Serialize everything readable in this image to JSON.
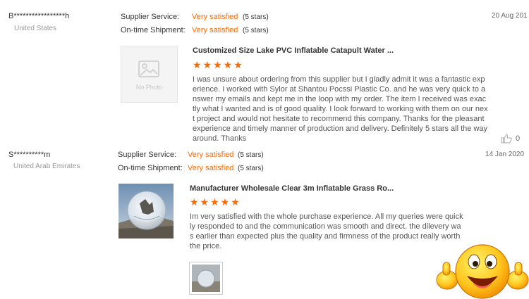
{
  "reviews": [
    {
      "buyer": "B*****************h",
      "country": "United States",
      "supplier_service_label": "Supplier Service:",
      "supplier_service_value": "Very satisfied",
      "supplier_service_stars": "(5 stars)",
      "shipment_label": "On-time Shipment:",
      "shipment_value": "Very satisfied",
      "shipment_stars": "(5 stars)",
      "date": "20 Aug 201",
      "photo_label": "No Photo",
      "product_title": "Customized Size Lake PVC Inflatable Catapult Water ...",
      "rating": 5,
      "stars": "★★★★★",
      "text": "I was unsure about ordering from this supplier but I gladly admit it was a fantastic experience. I worked with Sylor at Shantou Pocssi Plastic Co. and he was very quick to answer my emails and kept me in the loop with my order. The item I received was exactly what I wanted and is of good quality. I look forward to working with them on our next project and would not hesitate to recommend this company. Thanks for the pleasant experience and timely manner of production and delivery. Definitely 5 stars all the way around. Thanks",
      "likes": "0"
    },
    {
      "buyer": "S**********m",
      "country": "United Arab Emirates",
      "supplier_service_label": "Supplier Service:",
      "supplier_service_value": "Very satisfied",
      "supplier_service_stars": "(5 stars)",
      "shipment_label": "On-time Shipment:",
      "shipment_value": "Very satisfied",
      "shipment_stars": "(5 stars)",
      "date": "14 Jan 2020",
      "product_title": "Manufacturer Wholesale Clear 3m Inflatable Grass Ro...",
      "rating": 5,
      "stars": "★★★★★",
      "text": "Im very satisfied with the whole purchase experience. All my queries were quickly responded to and the communication was smooth and direct. the dilevery was earlier than expected plus the quality and firmness of the product really worth the price."
    }
  ],
  "icons": {
    "like": "thumbs-up-icon",
    "emoji": "thumbs-up-smiley-emoji"
  },
  "colors": {
    "accent": "#ff6a00",
    "text": "#333333",
    "muted": "#999999"
  }
}
